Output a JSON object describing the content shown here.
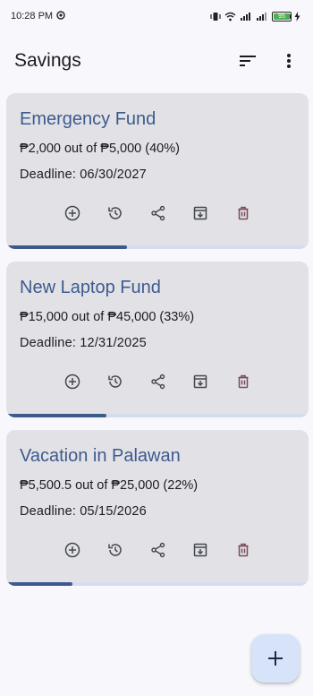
{
  "status_bar": {
    "time": "10:28 PM",
    "battery_level": "95",
    "network_label_1": "4G",
    "network_label_2": "5G"
  },
  "header": {
    "title": "Savings"
  },
  "colors": {
    "accent": "#3d5a8f",
    "card_bg": "#e2e2e6",
    "page_bg": "#f8f7fc",
    "fab_bg": "#d7e3f8",
    "delete_icon": "#7a4a5a"
  },
  "card_actions": [
    {
      "name": "add-funds",
      "icon": "plus-circle-icon"
    },
    {
      "name": "history",
      "icon": "history-icon"
    },
    {
      "name": "share",
      "icon": "share-icon"
    },
    {
      "name": "archive",
      "icon": "archive-icon"
    },
    {
      "name": "delete",
      "icon": "trash-icon"
    }
  ],
  "goals": [
    {
      "title": "Emergency Fund",
      "amount_text": "₱2,000 out of ₱5,000 (40%)",
      "deadline_text": "Deadline: 06/30/2027",
      "progress": 0.4
    },
    {
      "title": "New Laptop Fund",
      "amount_text": "₱15,000 out of ₱45,000 (33%)",
      "deadline_text": "Deadline: 12/31/2025",
      "progress": 0.33
    },
    {
      "title": "Vacation in Palawan",
      "amount_text": "₱5,500.5 out of ₱25,000 (22%)",
      "deadline_text": "Deadline: 05/15/2026",
      "progress": 0.22
    }
  ]
}
